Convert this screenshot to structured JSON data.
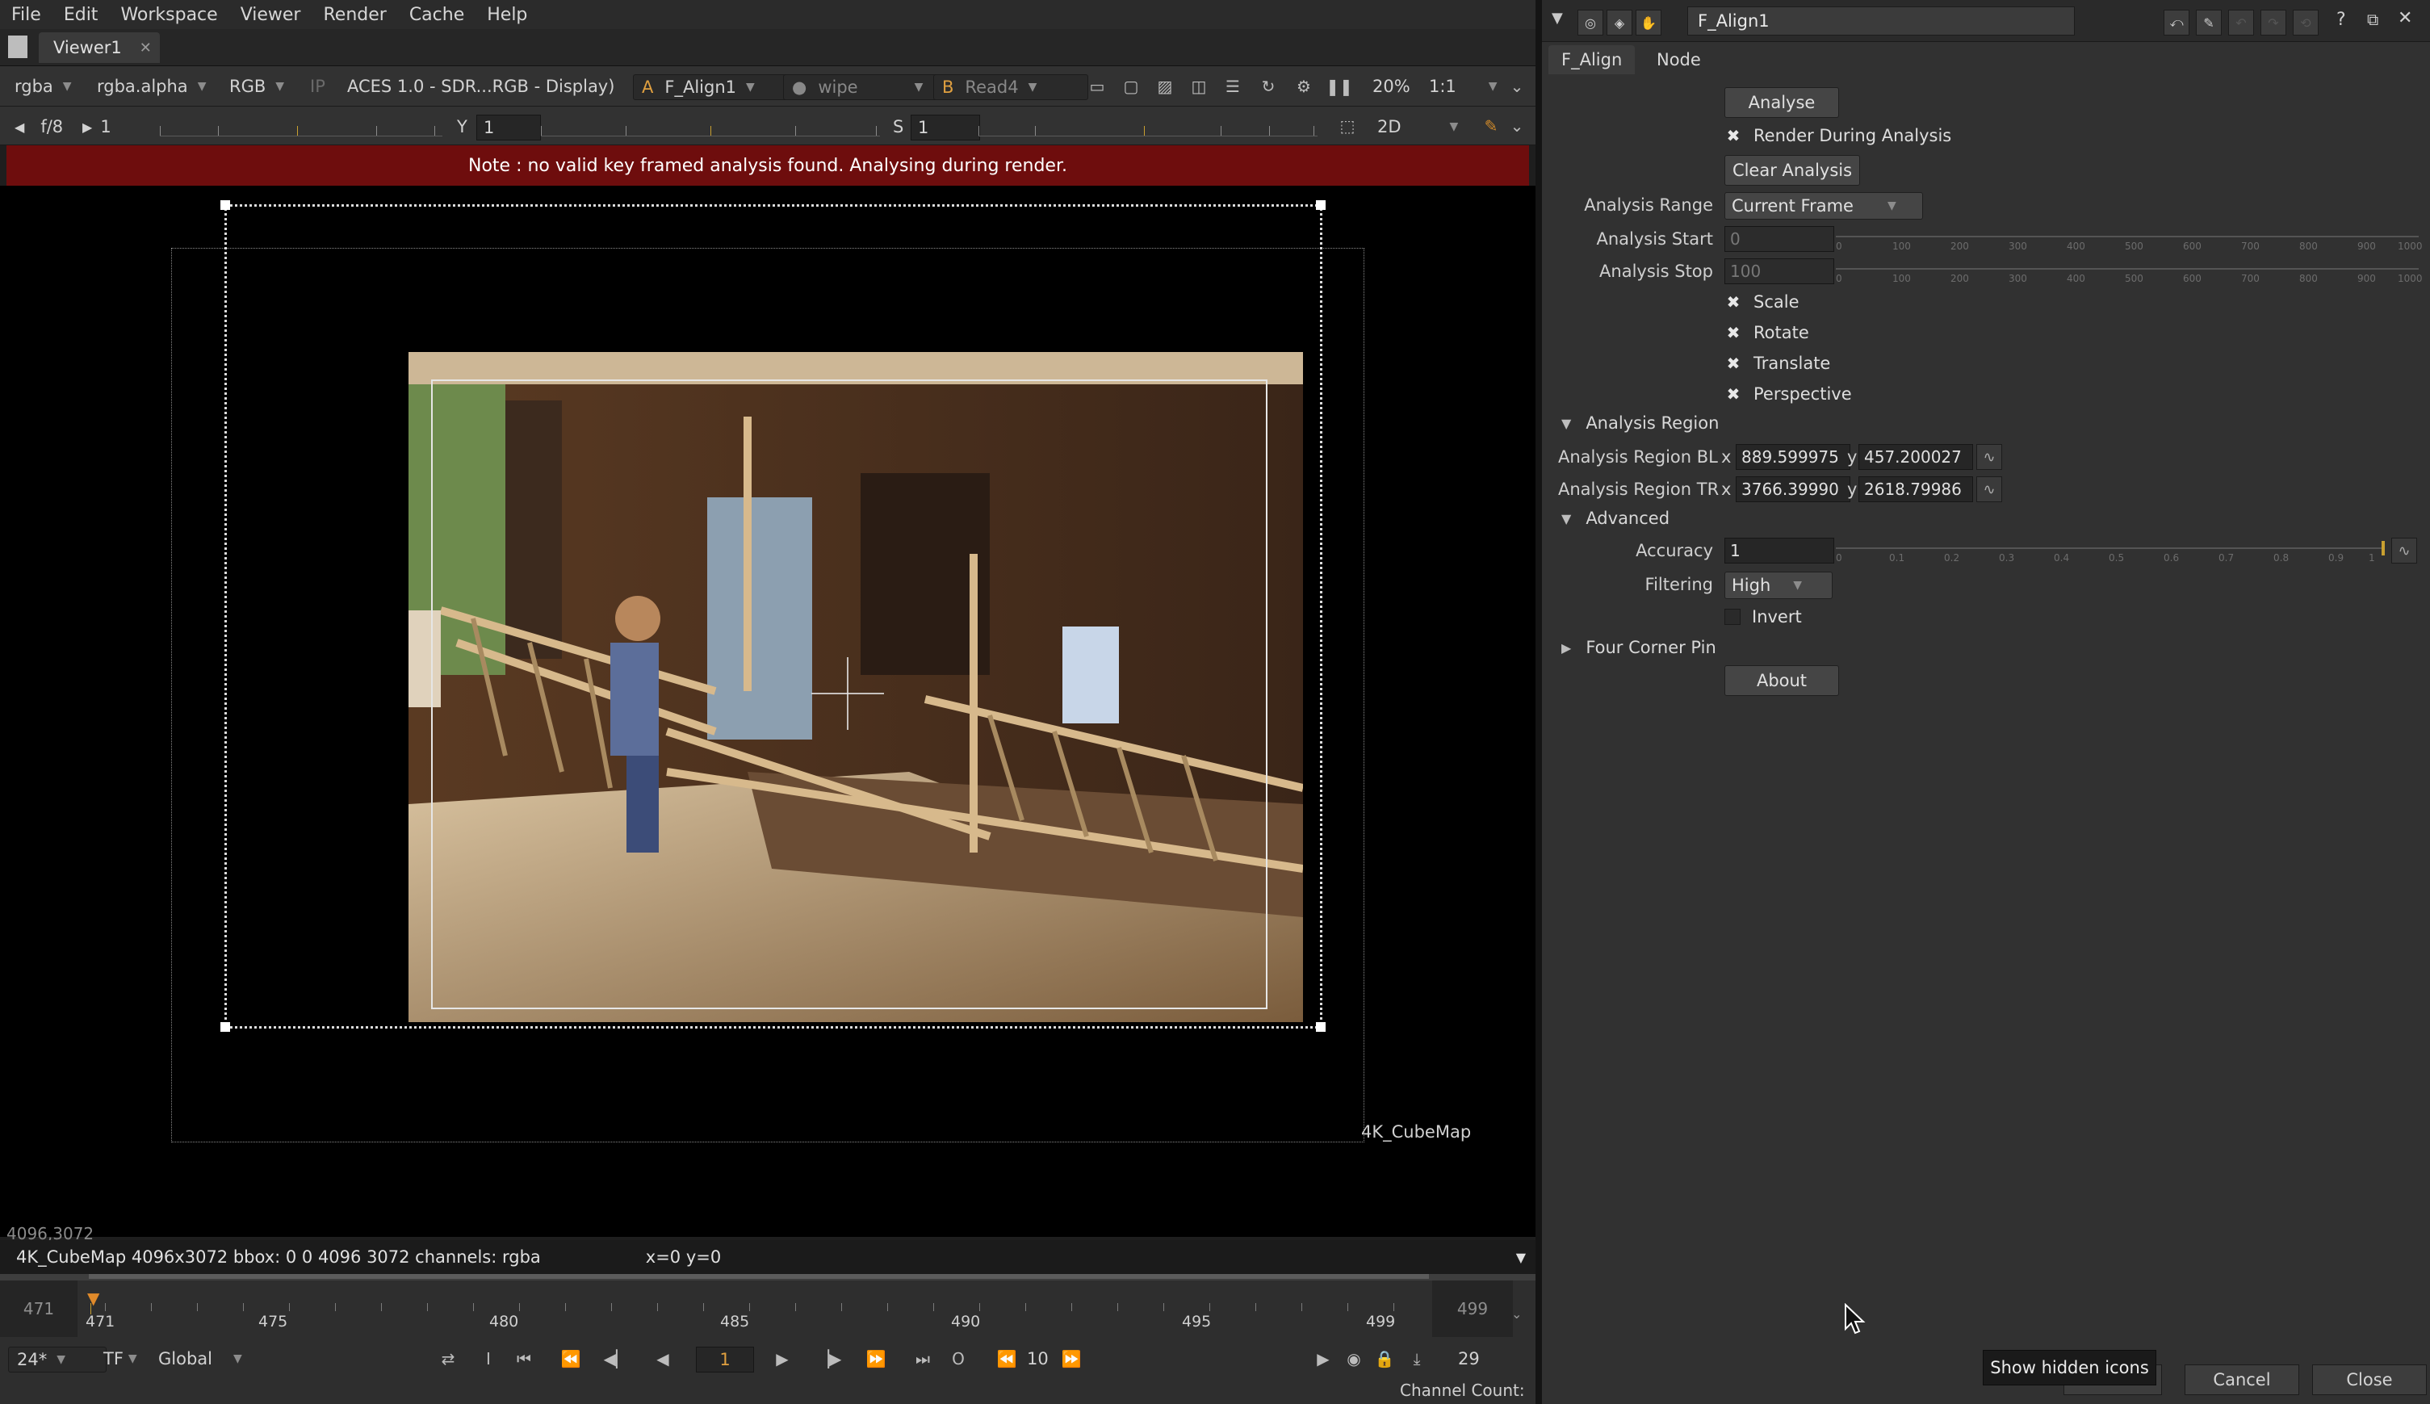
{
  "menu": [
    "File",
    "Edit",
    "Workspace",
    "Viewer",
    "Render",
    "Cache",
    "Help"
  ],
  "viewer_tab": {
    "label": "Viewer1",
    "close": "✕"
  },
  "toolbar1": {
    "channels": "rgba",
    "alpha": "rgba.alpha",
    "colorspace": "RGB",
    "ip": "IP",
    "display": "ACES 1.0 - SDR...RGB - Display)",
    "input_a_letter": "A",
    "input_a": "F_Align1",
    "wipe": "wipe",
    "input_b_letter": "B",
    "input_b": "Read4",
    "zoom": "20%",
    "ratio": "1:1"
  },
  "toolbar2": {
    "fstop": "f/8",
    "gain": "1",
    "gamma_label": "Y",
    "gamma": "1",
    "sat_label": "S",
    "sat": "1",
    "view_mode": "2D",
    "gain_ticks": [
      "0.015625",
      "0.1",
      "1",
      "10",
      "64"
    ],
    "gamma_ticks": [
      "0",
      "0.5",
      "1",
      "1.5",
      "2"
    ],
    "sat_ticks": [
      "0",
      "0.5",
      "1",
      "2",
      "3",
      "4"
    ]
  },
  "note": "Note : no valid key framed analysis found. Analysing during render.",
  "viewer": {
    "format_label": "4K_CubeMap",
    "size_label": "4096,3072"
  },
  "infobar": {
    "info": "4K_CubeMap 4096x3072  bbox: 0 0 4096 3072 channels: rgba",
    "coords": "x=0 y=0"
  },
  "timeline": {
    "start": "471",
    "end": "499",
    "labels": [
      "471",
      "475",
      "480",
      "485",
      "490",
      "495",
      "499"
    ],
    "current": "471"
  },
  "transport": {
    "fps": "24*",
    "tf": "TF",
    "scope": "Global",
    "frame": "1",
    "step": "10",
    "end_frame": "29"
  },
  "status": {
    "channel_count": "Channel Count:"
  },
  "props": {
    "node_name": "F_Align1",
    "tabs": [
      "F_Align",
      "Node"
    ],
    "analyse": "Analyse",
    "render_during": "Render During Analysis",
    "clear": "Clear Analysis",
    "range_label": "Analysis Range",
    "range_value": "Current Frame",
    "start_label": "Analysis Start",
    "start_value": "0",
    "stop_label": "Analysis Stop",
    "stop_value": "100",
    "range_ticks": [
      "0",
      "100",
      "200",
      "300",
      "400",
      "500",
      "600",
      "700",
      "800",
      "900",
      "1000"
    ],
    "scale": "Scale",
    "rotate": "Rotate",
    "translate": "Translate",
    "perspective": "Perspective",
    "region_section": "Analysis Region",
    "bl_label": "Analysis Region BL",
    "bl_x": "889.599975",
    "bl_y": "457.200027",
    "tr_label": "Analysis Region TR",
    "tr_x": "3766.39990",
    "tr_y": "2618.79986",
    "x": "x",
    "y": "y",
    "advanced_section": "Advanced",
    "accuracy_label": "Accuracy",
    "accuracy_value": "1",
    "accuracy_ticks": [
      "0",
      "0.1",
      "0.2",
      "0.3",
      "0.4",
      "0.5",
      "0.6",
      "0.7",
      "0.8",
      "0.9",
      "1"
    ],
    "filtering_label": "Filtering",
    "filtering_value": "High",
    "invert": "Invert",
    "fcp_section": "Four Corner Pin",
    "about": "About",
    "cancel": "Cancel",
    "close": "Close",
    "tooltip": "Show hidden icons"
  },
  "colors": {
    "note_bg": "#6e0d0d",
    "panel_bg": "#313131",
    "viewer_bg": "#000000",
    "accent": "#c9a030"
  }
}
